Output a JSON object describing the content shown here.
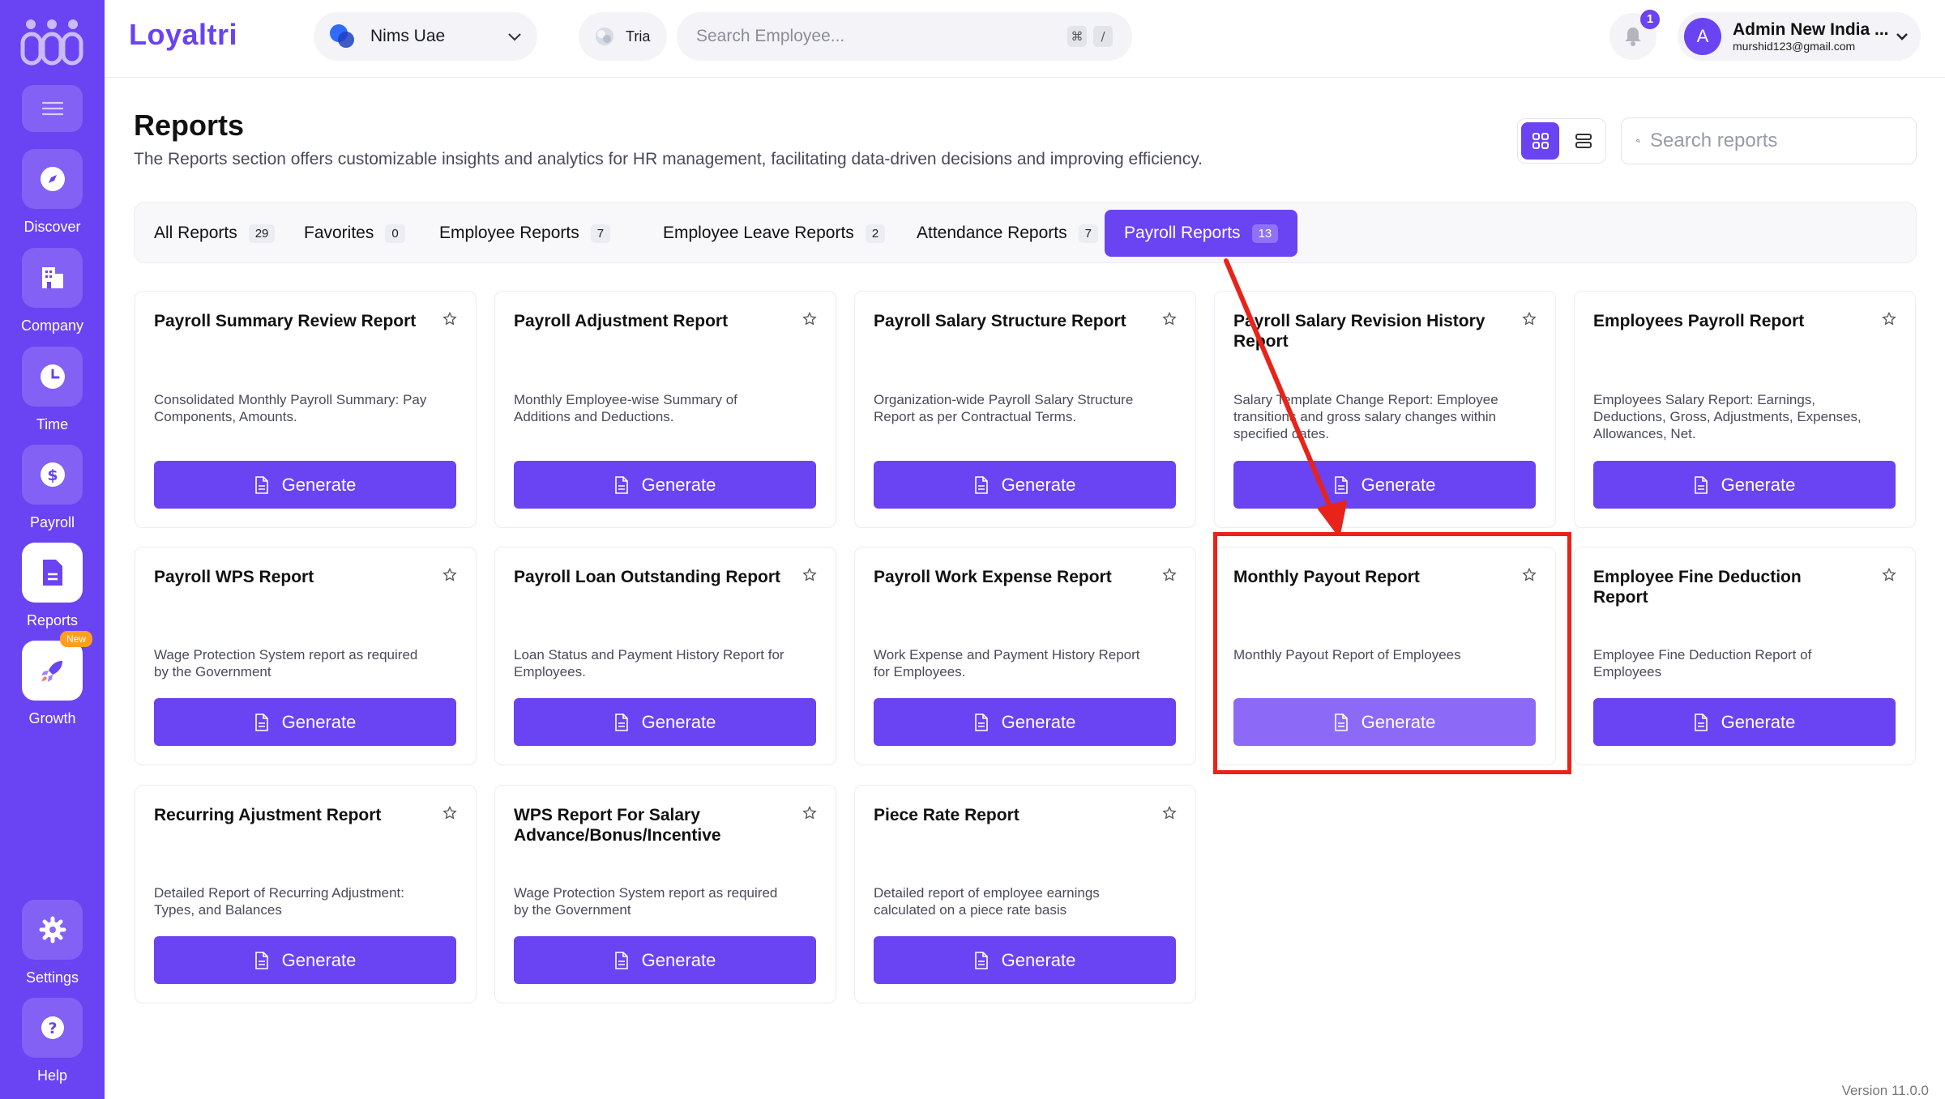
{
  "app": {
    "brand": "Loyaltri",
    "company": "Nims Uae",
    "assistant": "Tria",
    "search_placeholder": "Search Employee...",
    "kbd_cmd": "⌘",
    "kbd_slash": "/",
    "notifications": "1",
    "user": {
      "initial": "A",
      "name": "Admin New India ...",
      "email": "murshid123@gmail.com"
    },
    "version": "Version 11.0.0"
  },
  "sidebar": {
    "items": [
      {
        "label": "Discover"
      },
      {
        "label": "Company"
      },
      {
        "label": "Time"
      },
      {
        "label": "Payroll"
      },
      {
        "label": "Reports"
      },
      {
        "label": "Growth",
        "badge": "New"
      },
      {
        "label": "Settings"
      },
      {
        "label": "Help"
      }
    ]
  },
  "page": {
    "title": "Reports",
    "description": "The Reports section offers customizable insights and analytics for HR management, facilitating data-driven decisions and improving efficiency.",
    "search_placeholder": "Search reports"
  },
  "tabs": [
    {
      "label": "All Reports",
      "count": "29"
    },
    {
      "label": "Favorites",
      "count": "0"
    },
    {
      "label": "Employee Reports",
      "count": "7"
    },
    {
      "label": "Employee Leave Reports",
      "count": "2"
    },
    {
      "label": "Attendance Reports",
      "count": "7"
    },
    {
      "label": "Payroll Reports",
      "count": "13"
    }
  ],
  "generate_label": "Generate",
  "cards": [
    {
      "title": "Payroll Summary Review Report",
      "desc": "Consolidated Monthly Payroll Summary: Pay Components, Amounts."
    },
    {
      "title": "Payroll Adjustment Report",
      "desc": "Monthly Employee-wise Summary of Additions and Deductions."
    },
    {
      "title": "Payroll Salary Structure Report",
      "desc": "Organization-wide Payroll Salary Structure Report as per Contractual Terms."
    },
    {
      "title": "Payroll Salary Revision History Report",
      "desc": "Salary Template Change Report: Employee transitions and gross salary changes within specified dates."
    },
    {
      "title": "Employees Payroll Report",
      "desc": "Employees Salary Report: Earnings, Deductions, Gross, Adjustments, Expenses, Allowances, Net."
    },
    {
      "title": "Payroll WPS Report",
      "desc": "Wage Protection System report as required by the Government"
    },
    {
      "title": "Payroll Loan Outstanding Report",
      "desc": "Loan Status and Payment History Report for Employees."
    },
    {
      "title": "Payroll Work Expense Report",
      "desc": "Work Expense and Payment History Report for Employees."
    },
    {
      "title": "Monthly Payout Report",
      "desc": "Monthly Payout Report of Employees"
    },
    {
      "title": "Employee Fine Deduction Report",
      "desc": "Employee Fine Deduction Report of Employees"
    },
    {
      "title": "Recurring Ajustment Report",
      "desc": "Detailed Report of Recurring Adjustment: Types, and Balances"
    },
    {
      "title": "WPS Report For Salary Advance/Bonus/Incentive",
      "desc": "Wage Protection System report as required by the Government"
    },
    {
      "title": "Piece Rate Report",
      "desc": "Detailed report of employee earnings calculated on a piece rate basis"
    }
  ],
  "colors": {
    "accent": "#6a43f2",
    "annotation": "#e8231a"
  }
}
